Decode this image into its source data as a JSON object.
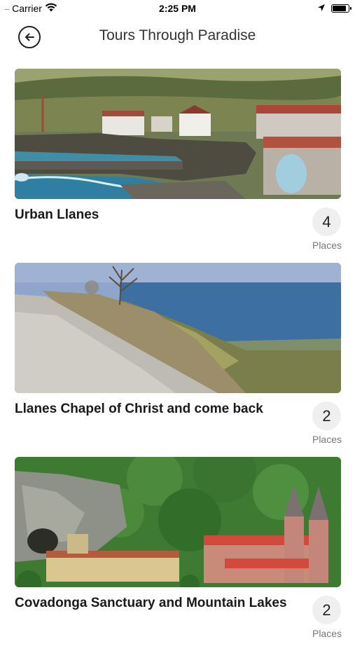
{
  "status_bar": {
    "signal": "....",
    "carrier": "Carrier",
    "time": "2:25 PM",
    "battery_level": 0.9
  },
  "header": {
    "title": "Tours Through Paradise",
    "back_icon": "arrow-left-circle-icon"
  },
  "tours": [
    {
      "title": "Urban Llanes",
      "places_count": "4",
      "places_label": "Places",
      "image": "coastal-town-photo"
    },
    {
      "title": "Llanes Chapel of Christ and come back",
      "places_count": "2",
      "places_label": "Places",
      "image": "coastal-path-photo"
    },
    {
      "title": "Covadonga Sanctuary and Mountain Lakes",
      "places_count": "2",
      "places_label": "Places",
      "image": "basilica-forest-photo"
    }
  ],
  "colors": {
    "badge_bg": "#efefef",
    "label_gray": "#777777",
    "title_text": "#1a1a1a"
  }
}
